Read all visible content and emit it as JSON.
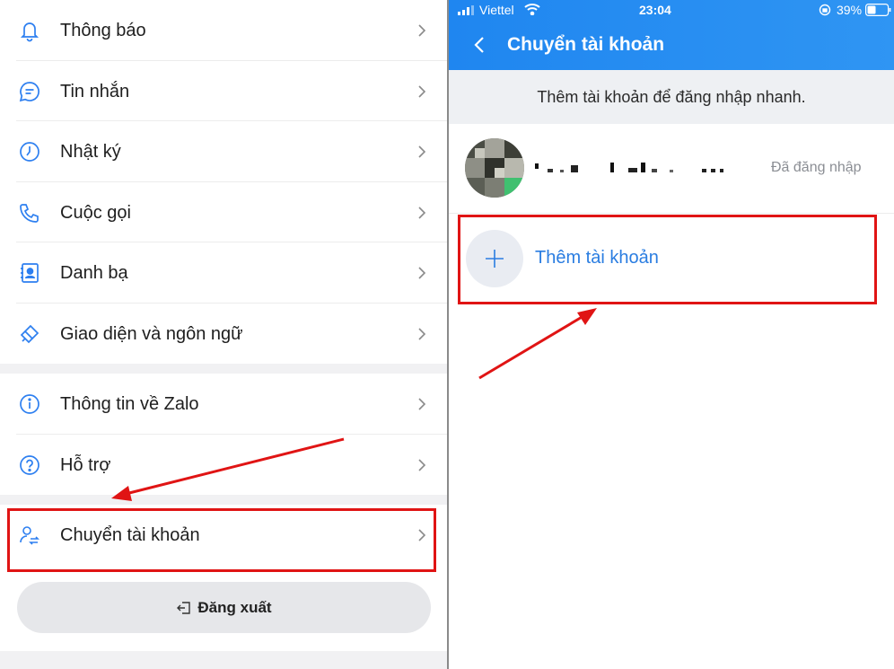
{
  "left_menu": {
    "items": [
      {
        "label": "Thông báo",
        "icon": "bell-icon"
      },
      {
        "label": "Tin nhắn",
        "icon": "chat-icon"
      },
      {
        "label": "Nhật ký",
        "icon": "clock-icon"
      },
      {
        "label": "Cuộc gọi",
        "icon": "phone-icon"
      },
      {
        "label": "Danh bạ",
        "icon": "contacts-icon"
      },
      {
        "label": "Giao diện và ngôn ngữ",
        "icon": "brush-icon"
      },
      {
        "label": "Thông tin về Zalo",
        "icon": "info-icon"
      },
      {
        "label": "Hỗ trợ",
        "icon": "help-icon"
      },
      {
        "label": "Chuyển tài khoản",
        "icon": "switch-account-icon"
      }
    ],
    "logout_label": "Đăng xuất"
  },
  "status_bar": {
    "carrier": "Viettel",
    "time": "23:04",
    "battery": "39%"
  },
  "header": {
    "title": "Chuyển tài khoản"
  },
  "hint_text": "Thêm tài khoản để đăng nhập nhanh.",
  "account": {
    "status": "Đã đăng nhập"
  },
  "add_account_label": "Thêm tài khoản",
  "colors": {
    "accent_blue": "#1f86f0",
    "link_blue": "#2a7de1",
    "annotation_red": "#e01414"
  }
}
